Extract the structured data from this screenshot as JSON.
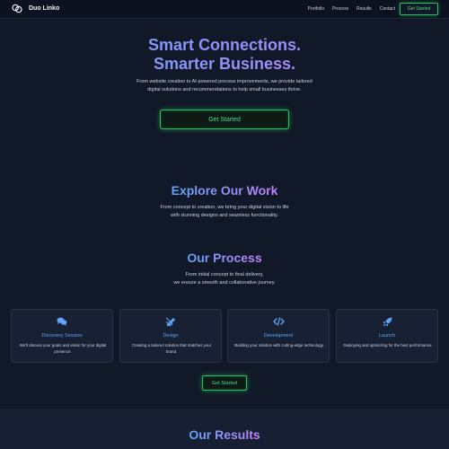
{
  "nav": {
    "brand": "Duo Linko",
    "links": [
      "Portfolio",
      "Process",
      "Results",
      "Contact"
    ],
    "cta": "Get Started"
  },
  "hero": {
    "title_line1": "Smart Connections.",
    "title_line2": "Smarter Business.",
    "subtitle": "From website creation to AI-powered process improvements, we provide tailored digital solutions and recommendations to help small businesses thrive.",
    "cta": "Get Started"
  },
  "work": {
    "title": "Explore Our Work",
    "subtitle_line1": "From concept to creation, we bring your digital vision to life",
    "subtitle_line2": "with stunning designs and seamless functionality."
  },
  "process": {
    "title": "Our Process",
    "subtitle_line1": "From initial concept to final delivery,",
    "subtitle_line2": "we ensure a smooth and collaborative journey.",
    "steps": [
      {
        "icon": "comments-icon",
        "title": "Discovery Session",
        "desc": "We'll discuss your goals and vision for your digital presence."
      },
      {
        "icon": "pencil-ruler-icon",
        "title": "Design",
        "desc": "Creating a tailored solution that matches your brand."
      },
      {
        "icon": "code-icon",
        "title": "Development",
        "desc": "Building your solution with cutting-edge technology."
      },
      {
        "icon": "rocket-icon",
        "title": "Launch",
        "desc": "Deploying and optimizing for the best performance."
      }
    ],
    "cta": "Get Started"
  },
  "results": {
    "title": "Our Results"
  },
  "colors": {
    "background": "#111827",
    "accent_green": "#22c55e",
    "accent_blue": "#60a5fa",
    "accent_purple": "#a78bfa"
  }
}
